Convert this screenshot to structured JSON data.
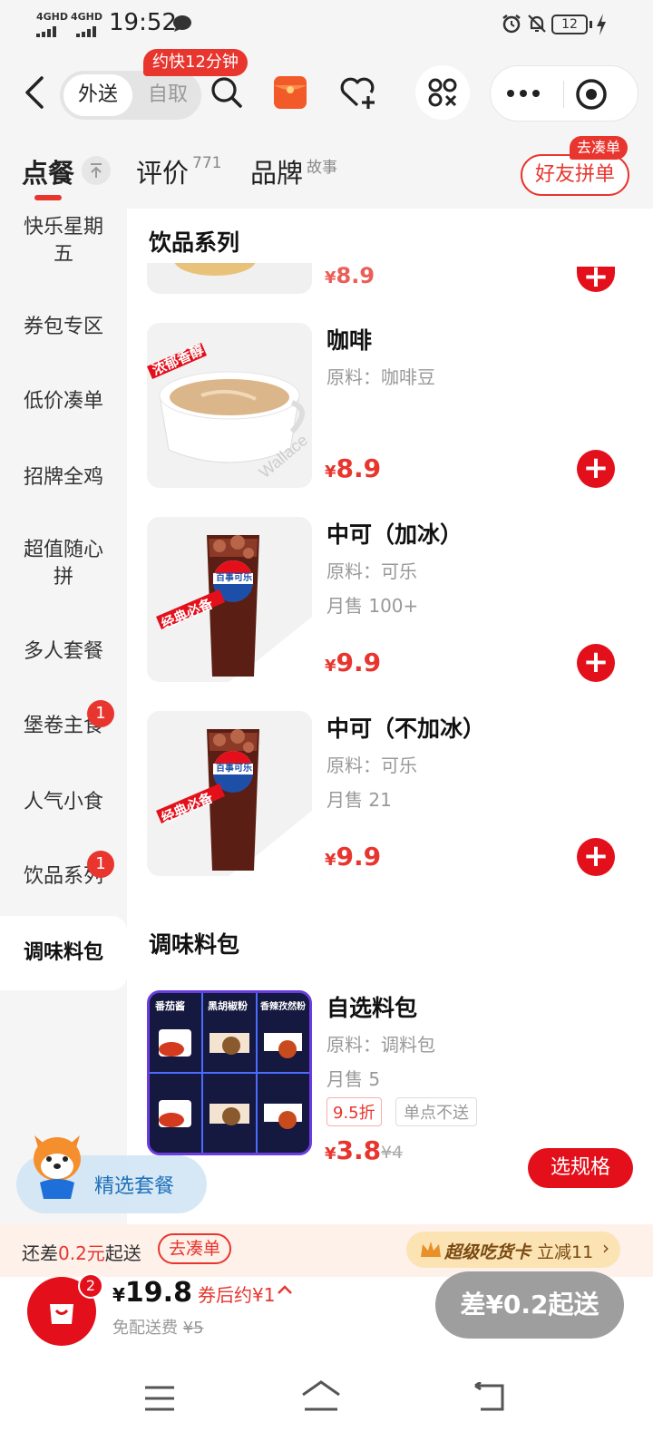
{
  "status_bar": {
    "sim1": "4GHD",
    "sim2": "4GHD",
    "time": "19:52",
    "battery": "12"
  },
  "header": {
    "toggle_delivery": "外送",
    "toggle_pickup": "自取",
    "delivery_tip": "约快12分钟"
  },
  "tabs": {
    "order": "点餐",
    "reviews": "评价",
    "reviews_count": "771",
    "brand": "品牌",
    "brand_sup": "故事",
    "group_order": "好友拼单",
    "group_badge": "去凑单"
  },
  "sidebar": {
    "items": [
      {
        "label": "快乐星期五"
      },
      {
        "label": "券包专区"
      },
      {
        "label": "低价凑单"
      },
      {
        "label": "招牌全鸡"
      },
      {
        "label": "超值随心拼"
      },
      {
        "label": "多人套餐"
      },
      {
        "label": "堡卷主食",
        "badge": "1"
      },
      {
        "label": "人气小食"
      },
      {
        "label": "饮品系列",
        "badge": "1"
      },
      {
        "label": "调味料包"
      }
    ]
  },
  "sections": {
    "drinks": "饮品系列",
    "seasoning": "调味料包"
  },
  "products": [
    {
      "name": "",
      "price": "8.9"
    },
    {
      "name": "咖啡",
      "desc": "原料：咖啡豆",
      "price": "8.9",
      "img_tag": "浓郁香醇",
      "watermark": "Wallace"
    },
    {
      "name": "中可（加冰）",
      "desc": "原料：可乐",
      "sales": "月售 100+",
      "price": "9.9",
      "img_tag": "经典必备",
      "brand": "百事可乐"
    },
    {
      "name": "中可（不加冰）",
      "desc": "原料：可乐",
      "sales": "月售 21",
      "price": "9.9",
      "img_tag": "经典必备",
      "brand": "百事可乐"
    },
    {
      "name": "自选料包",
      "desc": "原料：调料包",
      "sales": "月售 5",
      "discount": "9.5折",
      "note": "单点不送",
      "price": "3.8",
      "original_price": "¥4",
      "spec_button": "选规格",
      "img_labels": [
        "番茄酱",
        "黑胡椒粉",
        "香辣孜然粉"
      ]
    }
  ],
  "currency": "¥",
  "float_package": "精选套餐",
  "notice": {
    "prefix": "还差",
    "amount": "0.2元",
    "suffix": "起送",
    "btn": "去凑单",
    "card": "超级吃货卡",
    "card_offer": "立减11"
  },
  "cart": {
    "count": "2",
    "total": "19.8",
    "after_coupon": "券后约¥1",
    "delivery_fee_label": "免配送费",
    "delivery_fee_orig": "¥5",
    "checkout": "差¥0.2起送"
  },
  "colors": {
    "accent": "#e8352e",
    "add_button": "#e3101c"
  },
  "icons": [
    "back-icon",
    "search-icon",
    "red-packet-icon",
    "heart-plus-icon",
    "scan-icon",
    "more-icon",
    "target-icon",
    "pin-top-icon",
    "plus-icon",
    "cart-icon",
    "chevron-up-icon",
    "crown-icon",
    "menu-icon",
    "home-icon",
    "return-icon"
  ]
}
